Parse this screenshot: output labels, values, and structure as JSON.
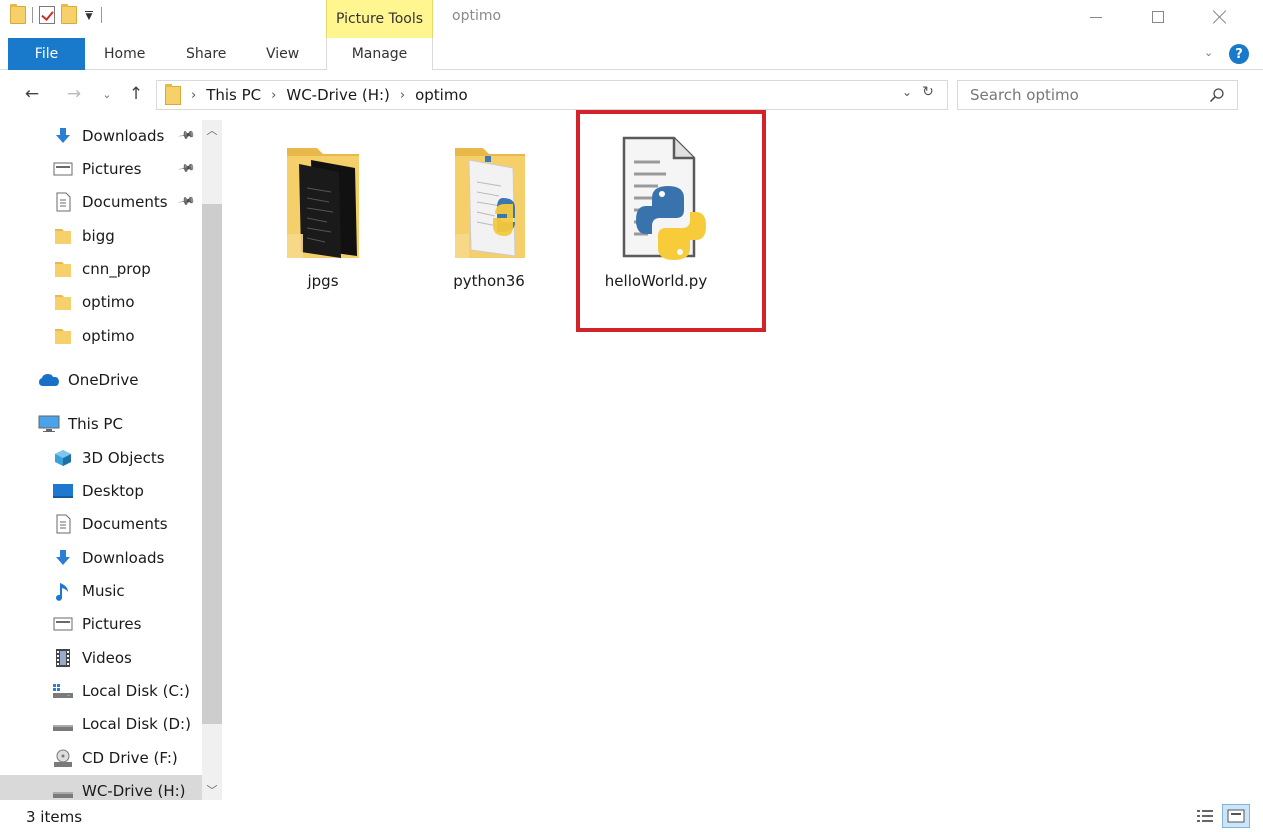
{
  "window": {
    "title": "optimo",
    "picture_tools": "Picture Tools"
  },
  "ribbon": {
    "file": "File",
    "home": "Home",
    "share": "Share",
    "view": "View",
    "manage": "Manage"
  },
  "address": {
    "crumbs": [
      "This PC",
      "WC-Drive (H:)",
      "optimo"
    ]
  },
  "search": {
    "placeholder": "Search optimo"
  },
  "nav_pane": {
    "items": [
      {
        "label": "Downloads",
        "icon": "download-arrow-icon",
        "pinned": true
      },
      {
        "label": "Pictures",
        "icon": "pictures-icon",
        "pinned": true
      },
      {
        "label": "Documents",
        "icon": "documents-icon",
        "pinned": true
      },
      {
        "label": "bigg",
        "icon": "folder-icon"
      },
      {
        "label": "cnn_prop",
        "icon": "folder-icon"
      },
      {
        "label": "optimo",
        "icon": "folder-icon"
      },
      {
        "label": "optimo",
        "icon": "folder-icon"
      },
      {
        "label": "OneDrive",
        "icon": "onedrive-cloud-icon"
      },
      {
        "label": "This PC",
        "icon": "computer-icon"
      },
      {
        "label": "3D Objects",
        "icon": "3d-objects-icon"
      },
      {
        "label": "Desktop",
        "icon": "desktop-icon"
      },
      {
        "label": "Documents",
        "icon": "documents-icon"
      },
      {
        "label": "Downloads",
        "icon": "download-arrow-icon"
      },
      {
        "label": "Music",
        "icon": "music-note-icon"
      },
      {
        "label": "Pictures",
        "icon": "pictures-icon"
      },
      {
        "label": "Videos",
        "icon": "videos-icon"
      },
      {
        "label": "Local Disk (C:)",
        "icon": "windows-drive-icon"
      },
      {
        "label": "Local Disk (D:)",
        "icon": "drive-icon"
      },
      {
        "label": "CD Drive (F:)",
        "icon": "cd-drive-icon"
      },
      {
        "label": "WC-Drive (H:)",
        "icon": "drive-icon",
        "selected": true
      }
    ]
  },
  "files": [
    {
      "name": "jpgs",
      "icon": "folder-with-images-icon"
    },
    {
      "name": "python36",
      "icon": "folder-with-python-icon"
    },
    {
      "name": "helloWorld.py",
      "icon": "python-file-icon",
      "highlighted": true
    }
  ],
  "status": {
    "item_count": "3 items"
  },
  "colors": {
    "accent": "#1979ca",
    "picture_tools": "#fff68f",
    "highlight": "#d3232a"
  }
}
